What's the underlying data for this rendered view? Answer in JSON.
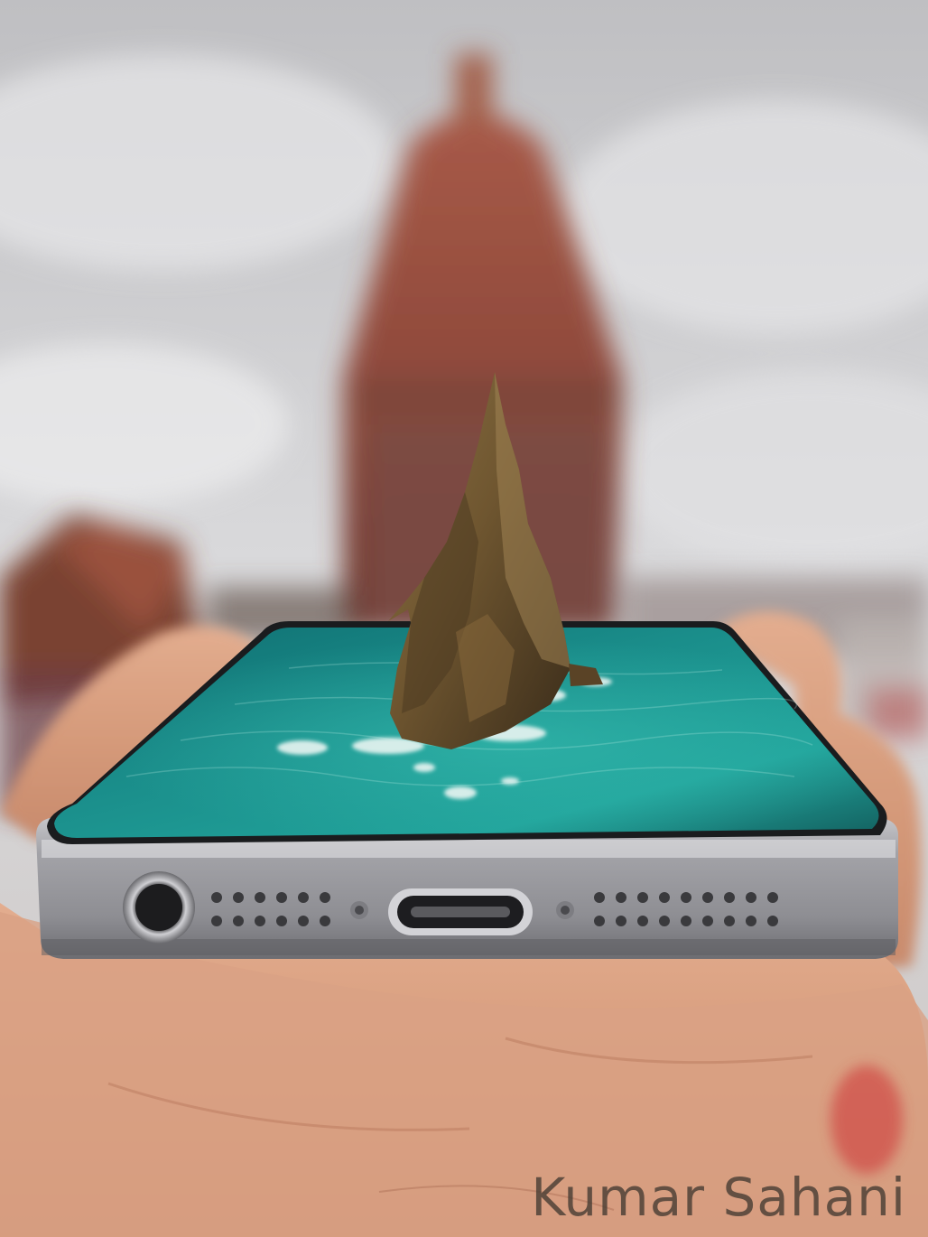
{
  "scene": {
    "subject": "smartphone-with-sea-stack-illusion",
    "background": "blurred-temple",
    "colors": {
      "sky": "#d4d4d6",
      "temple": "#8a4a3c",
      "sea": "#1f8f8c",
      "rock": "#6b5430",
      "phone_metal": "#9a9a9f",
      "skin": "#d79e7e"
    }
  },
  "watermark": {
    "text": "Kumar Sahani"
  }
}
